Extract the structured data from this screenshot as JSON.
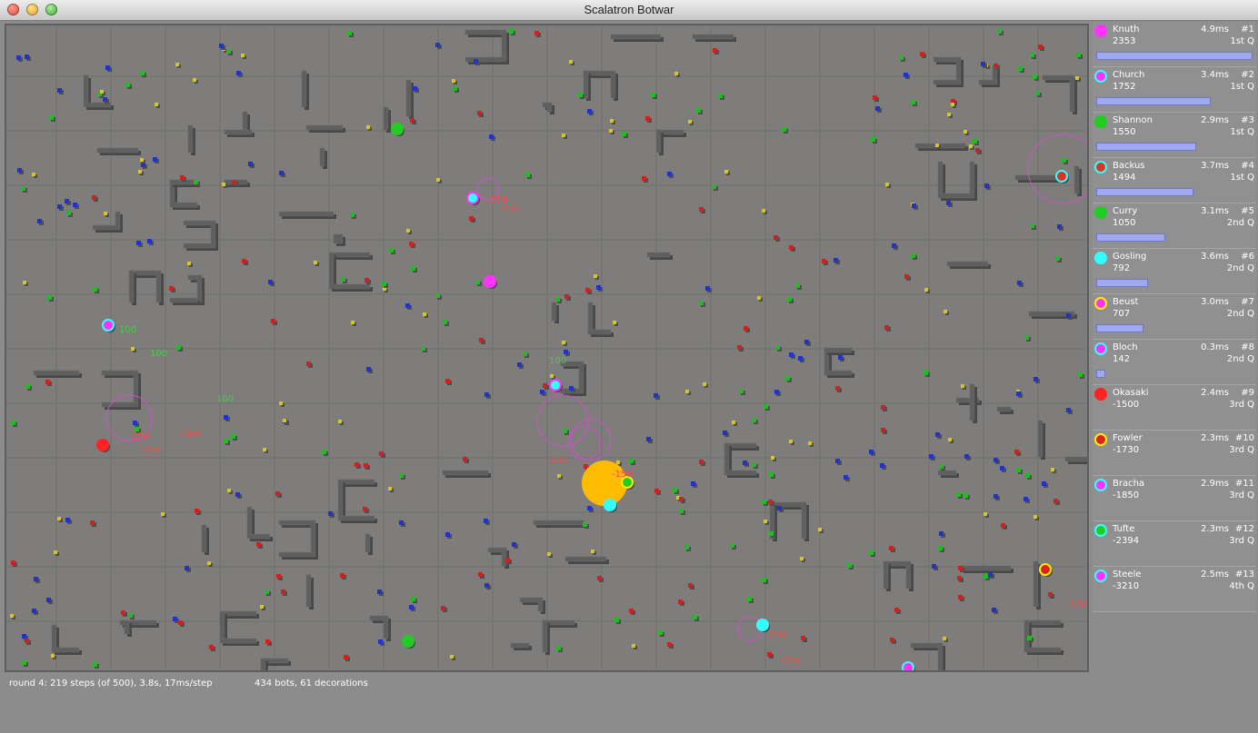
{
  "window": {
    "title": "Scalatron Botwar"
  },
  "status": {
    "round_text": "round 4: 219 steps (of 500), 3.8s, 17ms/step",
    "counts_text": "434 bots, 61 decorations"
  },
  "colors": {
    "arena": "#7e7d7c",
    "wall": "#5a5a5a",
    "grid": "#6c6c6c"
  },
  "leaderboard": [
    {
      "name": "Knuth",
      "score": "2353",
      "time": "4.9ms",
      "rank": "#1",
      "quartile": "1st Q",
      "color": "#ff33ff",
      "ring": "#ff33ff",
      "progress": 1.0
    },
    {
      "name": "Church",
      "score": "1752",
      "time": "3.4ms",
      "rank": "#2",
      "quartile": "1st Q",
      "color": "#ff33ff",
      "ring": "#33ffff",
      "progress": 0.73
    },
    {
      "name": "Shannon",
      "score": "1550",
      "time": "2.9ms",
      "rank": "#3",
      "quartile": "1st Q",
      "color": "#22cc22",
      "ring": "#22cc22",
      "progress": 0.64
    },
    {
      "name": "Backus",
      "score": "1494",
      "time": "3.7ms",
      "rank": "#4",
      "quartile": "1st Q",
      "color": "#dd3322",
      "ring": "#33ffff",
      "progress": 0.62
    },
    {
      "name": "Curry",
      "score": "1050",
      "time": "3.1ms",
      "rank": "#5",
      "quartile": "2nd Q",
      "color": "#22cc22",
      "ring": "#22cc22",
      "progress": 0.44
    },
    {
      "name": "Gosling",
      "score": "792",
      "time": "3.6ms",
      "rank": "#6",
      "quartile": "2nd Q",
      "color": "#33ffff",
      "ring": "#33ffff",
      "progress": 0.33
    },
    {
      "name": "Beust",
      "score": "707",
      "time": "3.0ms",
      "rank": "#7",
      "quartile": "2nd Q",
      "color": "#ff33ff",
      "ring": "#ffee00",
      "progress": 0.3
    },
    {
      "name": "Bloch",
      "score": "142",
      "time": "0.3ms",
      "rank": "#8",
      "quartile": "2nd Q",
      "color": "#ff33ff",
      "ring": "#33ffff",
      "progress": 0.06
    },
    {
      "name": "Okasaki",
      "score": "-1500",
      "time": "2.4ms",
      "rank": "#9",
      "quartile": "3rd Q",
      "color": "#ff2222",
      "ring": "#ff2222",
      "progress": 0
    },
    {
      "name": "Fowler",
      "score": "-1730",
      "time": "2.3ms",
      "rank": "#10",
      "quartile": "3rd Q",
      "color": "#dd2222",
      "ring": "#ffee00",
      "progress": 0
    },
    {
      "name": "Bracha",
      "score": "-1850",
      "time": "2.9ms",
      "rank": "#11",
      "quartile": "3rd Q",
      "color": "#ff33ff",
      "ring": "#33ffff",
      "progress": 0
    },
    {
      "name": "Tufte",
      "score": "-2394",
      "time": "2.3ms",
      "rank": "#12",
      "quartile": "3rd Q",
      "color": "#22cc22",
      "ring": "#33ffff",
      "progress": 0
    },
    {
      "name": "Steele",
      "score": "-3210",
      "time": "2.5ms",
      "rank": "#13",
      "quartile": "4th Q",
      "color": "#ff33ff",
      "ring": "#33ffff",
      "progress": 0
    }
  ],
  "arena_labels": [
    {
      "text": "-150",
      "color": "#ff4444"
    },
    {
      "text": "-150",
      "color": "#ff4444"
    },
    {
      "text": "100",
      "color": "#44cc44"
    },
    {
      "text": "100",
      "color": "#44cc44"
    },
    {
      "text": "-150",
      "color": "#ff4444"
    },
    {
      "text": "-150",
      "color": "#ff4444"
    },
    {
      "text": "-100",
      "color": "#ff4444"
    },
    {
      "text": "100",
      "color": "#44cc44"
    },
    {
      "text": "100",
      "color": "#44cc44"
    },
    {
      "text": "-150",
      "color": "#ff4444"
    },
    {
      "text": "-150",
      "color": "#ff4444"
    },
    {
      "text": "-150",
      "color": "#ff4444"
    },
    {
      "text": "-150",
      "color": "#ff4444"
    },
    {
      "text": "-150",
      "color": "#ff4444"
    }
  ]
}
